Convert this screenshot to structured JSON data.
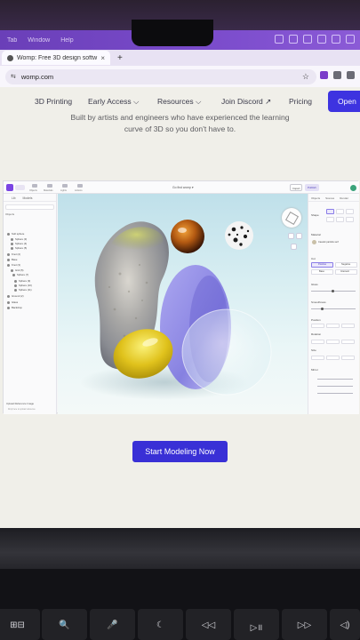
{
  "browser": {
    "menubar": [
      "Tab",
      "Window",
      "Help"
    ],
    "tab_title": "Womp: Free 3D design softw",
    "tab_close": "×",
    "new_tab": "+",
    "url": "womp.com",
    "url_tune": "⇆",
    "star": "☆"
  },
  "site": {
    "nav": [
      "3D Printing",
      "Early Access ⌵",
      "Resources ⌵",
      "Join Discord ↗",
      "Pricing"
    ],
    "open_button": "Open",
    "hero_line1": "Built by artists and engineers who have experienced the learning",
    "hero_line2": "curve of 3D so you don't have to.",
    "cta": "Start Modeling Now"
  },
  "app": {
    "file_name": "Go find womp ▾",
    "import": "Import",
    "publish": "Publish",
    "left_tabs": [
      "Lib",
      "Models"
    ],
    "left_heading": "Objects",
    "tree": [
      "Soft sphere",
      "Sphere (3)",
      "Sphere (4)",
      "Sphere (5)",
      "Knot (2)",
      "Base",
      "Knot (3)",
      "Grid (5)",
      "Sphere (7)",
      "Sphere (9)",
      "Sphere (10)",
      "Sphere (11)",
      "Ground (2)",
      "Glass",
      "Backdrop"
    ],
    "reference": "Upload Reference Image",
    "reference_note": "Drop here to upload reference",
    "toolbar_labels": [
      "Objects",
      "Materials",
      "Lights",
      "Actions"
    ],
    "right_tabs": [
      "Objects",
      "Scenes",
      "Render"
    ],
    "right_labels": [
      "Shape",
      "Material",
      "Cut",
      "Gloss",
      "Smoothness",
      "Position",
      "Rotation",
      "Size",
      "Mirror"
    ],
    "material_name": "Caustic particle surf",
    "mode_options": [
      "Positive",
      "Negative",
      "Base",
      "Intersect"
    ]
  },
  "keyboard": [
    "⊞⊟",
    "🔍",
    "🎤",
    "☾",
    "◁◁",
    "▷॥",
    "▷▷",
    "◁)"
  ],
  "colors": {
    "accent": "#3930d6",
    "menubar": "#7b4ccc"
  }
}
